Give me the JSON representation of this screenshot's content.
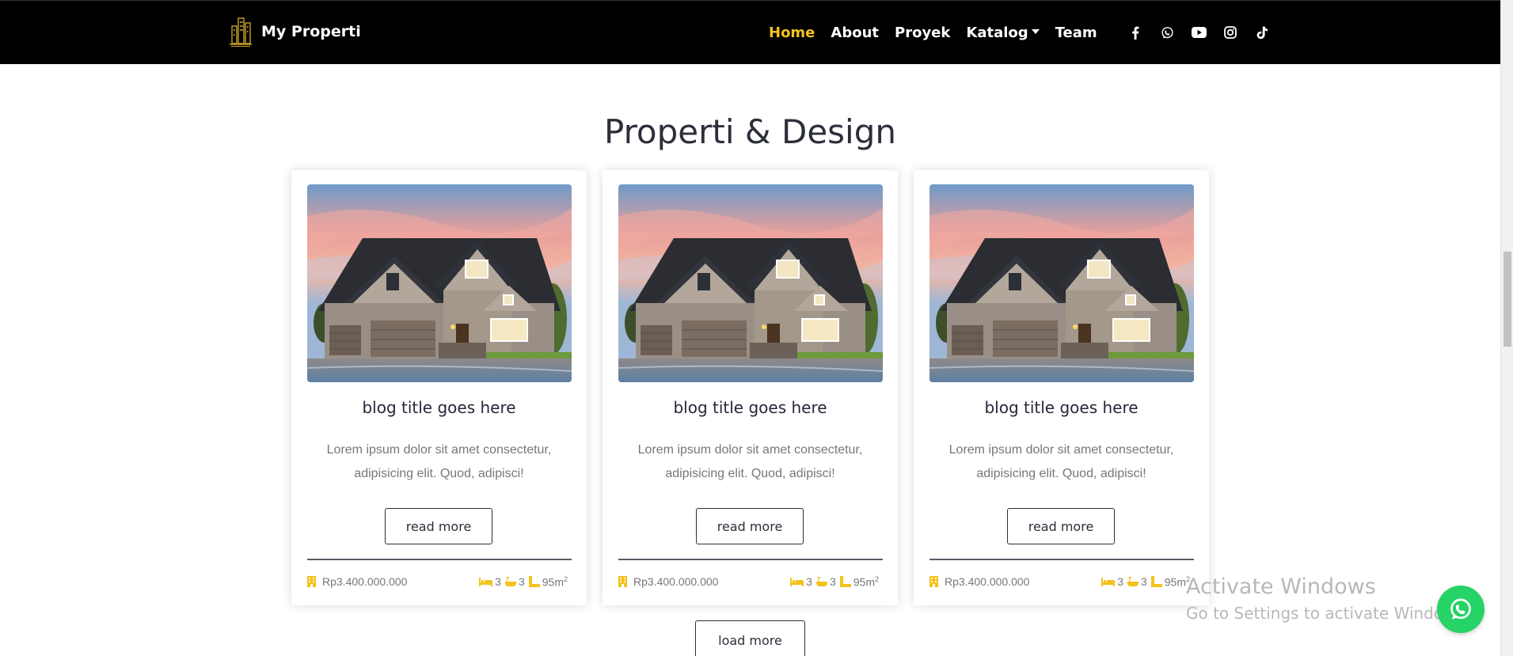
{
  "navbar": {
    "brand": "My Properti",
    "links": [
      {
        "label": "Home",
        "active": true
      },
      {
        "label": "About"
      },
      {
        "label": "Proyek"
      },
      {
        "label": "Katalog",
        "dropdown": true
      },
      {
        "label": "Team"
      }
    ],
    "socials": [
      "facebook-icon",
      "whatsapp-icon",
      "youtube-icon",
      "instagram-icon",
      "tiktok-icon"
    ],
    "accent_color": "#f4c21b"
  },
  "section": {
    "title": "Properti & Design",
    "cards": [
      {
        "title": "blog title goes here",
        "text": "Lorem ipsum dolor sit amet consectetur, adipisicing elit. Quod, adipisci!",
        "button": "read more",
        "price": "Rp3.400.000.000",
        "bedrooms": "3",
        "bathrooms": "3",
        "area": "95m",
        "area_sup": "2"
      },
      {
        "title": "blog title goes here",
        "text": "Lorem ipsum dolor sit amet consectetur, adipisicing elit. Quod, adipisci!",
        "button": "read more",
        "price": "Rp3.400.000.000",
        "bedrooms": "3",
        "bathrooms": "3",
        "area": "95m",
        "area_sup": "2"
      },
      {
        "title": "blog title goes here",
        "text": "Lorem ipsum dolor sit amet consectetur, adipisicing elit. Quod, adipisci!",
        "button": "read more",
        "price": "Rp3.400.000.000",
        "bedrooms": "3",
        "bathrooms": "3",
        "area": "95m",
        "area_sup": "2"
      }
    ],
    "load_more": "load more"
  },
  "watermark": {
    "title": "Activate Windows",
    "subtitle": "Go to Settings to activate Windows."
  },
  "floating": {
    "icon": "whatsapp-icon",
    "color": "#25d366"
  }
}
